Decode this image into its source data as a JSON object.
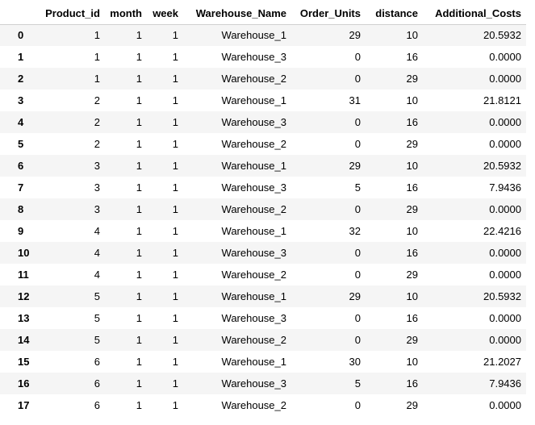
{
  "table": {
    "index_header": "",
    "columns": [
      "Product_id",
      "month",
      "week",
      "Warehouse_Name",
      "Order_Units",
      "distance",
      "Additional_Costs"
    ],
    "rows": [
      {
        "index": "0",
        "cells": [
          "1",
          "1",
          "1",
          "Warehouse_1",
          "29",
          "10",
          "20.5932"
        ]
      },
      {
        "index": "1",
        "cells": [
          "1",
          "1",
          "1",
          "Warehouse_3",
          "0",
          "16",
          "0.0000"
        ]
      },
      {
        "index": "2",
        "cells": [
          "1",
          "1",
          "1",
          "Warehouse_2",
          "0",
          "29",
          "0.0000"
        ]
      },
      {
        "index": "3",
        "cells": [
          "2",
          "1",
          "1",
          "Warehouse_1",
          "31",
          "10",
          "21.8121"
        ]
      },
      {
        "index": "4",
        "cells": [
          "2",
          "1",
          "1",
          "Warehouse_3",
          "0",
          "16",
          "0.0000"
        ]
      },
      {
        "index": "5",
        "cells": [
          "2",
          "1",
          "1",
          "Warehouse_2",
          "0",
          "29",
          "0.0000"
        ]
      },
      {
        "index": "6",
        "cells": [
          "3",
          "1",
          "1",
          "Warehouse_1",
          "29",
          "10",
          "20.5932"
        ]
      },
      {
        "index": "7",
        "cells": [
          "3",
          "1",
          "1",
          "Warehouse_3",
          "5",
          "16",
          "7.9436"
        ]
      },
      {
        "index": "8",
        "cells": [
          "3",
          "1",
          "1",
          "Warehouse_2",
          "0",
          "29",
          "0.0000"
        ]
      },
      {
        "index": "9",
        "cells": [
          "4",
          "1",
          "1",
          "Warehouse_1",
          "32",
          "10",
          "22.4216"
        ]
      },
      {
        "index": "10",
        "cells": [
          "4",
          "1",
          "1",
          "Warehouse_3",
          "0",
          "16",
          "0.0000"
        ]
      },
      {
        "index": "11",
        "cells": [
          "4",
          "1",
          "1",
          "Warehouse_2",
          "0",
          "29",
          "0.0000"
        ]
      },
      {
        "index": "12",
        "cells": [
          "5",
          "1",
          "1",
          "Warehouse_1",
          "29",
          "10",
          "20.5932"
        ]
      },
      {
        "index": "13",
        "cells": [
          "5",
          "1",
          "1",
          "Warehouse_3",
          "0",
          "16",
          "0.0000"
        ]
      },
      {
        "index": "14",
        "cells": [
          "5",
          "1",
          "1",
          "Warehouse_2",
          "0",
          "29",
          "0.0000"
        ]
      },
      {
        "index": "15",
        "cells": [
          "6",
          "1",
          "1",
          "Warehouse_1",
          "30",
          "10",
          "21.2027"
        ]
      },
      {
        "index": "16",
        "cells": [
          "6",
          "1",
          "1",
          "Warehouse_3",
          "5",
          "16",
          "7.9436"
        ]
      },
      {
        "index": "17",
        "cells": [
          "6",
          "1",
          "1",
          "Warehouse_2",
          "0",
          "29",
          "0.0000"
        ]
      }
    ]
  },
  "colors": {
    "row_stripe": "#f5f5f5",
    "header_rule": "#cfcfcf",
    "text": "#000000"
  }
}
